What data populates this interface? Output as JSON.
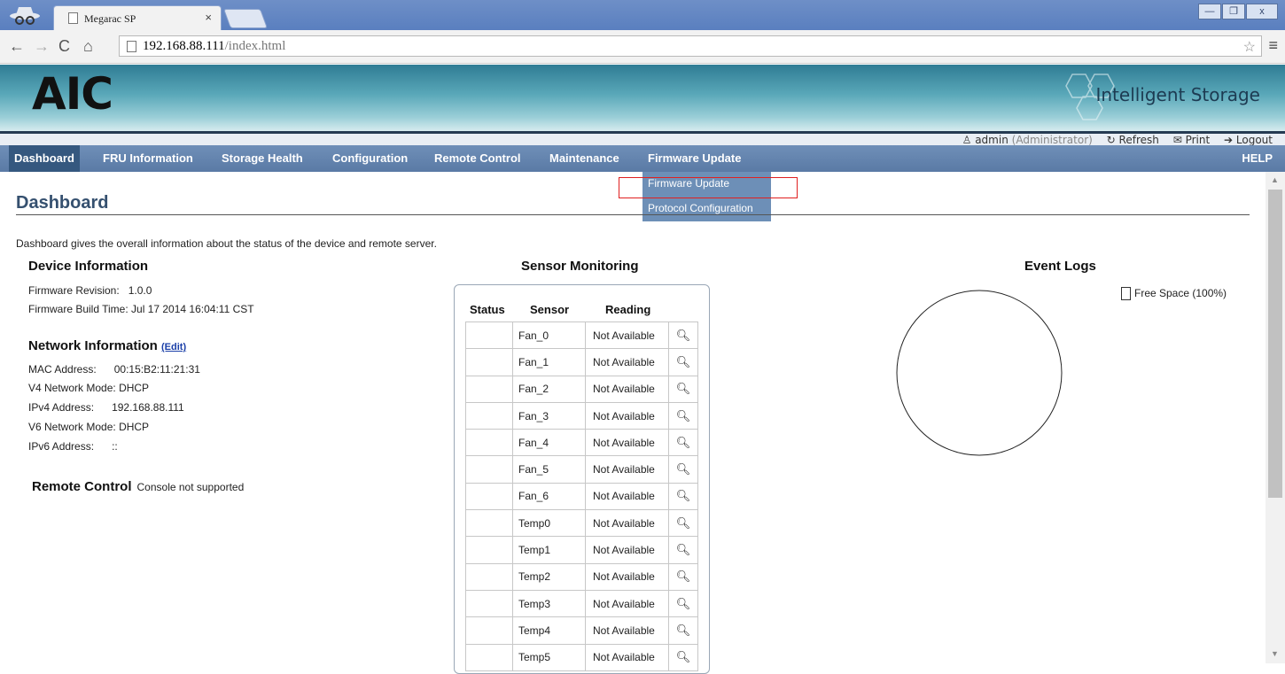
{
  "browser": {
    "tab_title": "Megarac SP",
    "tab_close": "×",
    "url_host": "192.168.88.111",
    "url_path": "/index.html",
    "window_controls": [
      "—",
      "❐",
      "x"
    ]
  },
  "header": {
    "logo": "AIC",
    "tagline": "Intelligent Storage"
  },
  "userbar": {
    "user": "admin",
    "role": "(Administrator)",
    "refresh": "Refresh",
    "print": "Print",
    "logout": "Logout"
  },
  "nav": {
    "items": [
      "Dashboard",
      "FRU Information",
      "Storage Health",
      "Configuration",
      "Remote Control",
      "Maintenance",
      "Firmware Update"
    ],
    "help": "HELP",
    "dropdown": [
      "Firmware Update",
      "Protocol Configuration"
    ]
  },
  "page": {
    "title": "Dashboard",
    "description": "Dashboard gives the overall information about the status of the device and remote server."
  },
  "device_info": {
    "heading": "Device Information",
    "firmware_revision_label": "Firmware Revision:",
    "firmware_revision": "1.0.0",
    "build_time_label": "Firmware Build Time:",
    "build_time": "Jul 17 2014 16:04:11 CST"
  },
  "network_info": {
    "heading": "Network Information",
    "edit": "(Edit)",
    "mac_label": "MAC Address:",
    "mac": "00:15:B2:11:21:31",
    "v4_mode_label": "V4 Network Mode:",
    "v4_mode": "DHCP",
    "ipv4_label": "IPv4 Address:",
    "ipv4": "192.168.88.111",
    "v6_mode_label": "V6 Network Mode:",
    "v6_mode": "DHCP",
    "ipv6_label": "IPv6 Address:",
    "ipv6": "::"
  },
  "remote_control": {
    "heading": "Remote Control",
    "status": "Console not supported"
  },
  "sensor_monitoring": {
    "heading": "Sensor Monitoring",
    "columns": [
      "Status",
      "Sensor",
      "Reading"
    ],
    "rows": [
      {
        "sensor": "Fan_0",
        "reading": "Not Available"
      },
      {
        "sensor": "Fan_1",
        "reading": "Not Available"
      },
      {
        "sensor": "Fan_2",
        "reading": "Not Available"
      },
      {
        "sensor": "Fan_3",
        "reading": "Not Available"
      },
      {
        "sensor": "Fan_4",
        "reading": "Not Available"
      },
      {
        "sensor": "Fan_5",
        "reading": "Not Available"
      },
      {
        "sensor": "Fan_6",
        "reading": "Not Available"
      },
      {
        "sensor": "Temp0",
        "reading": "Not Available"
      },
      {
        "sensor": "Temp1",
        "reading": "Not Available"
      },
      {
        "sensor": "Temp2",
        "reading": "Not Available"
      },
      {
        "sensor": "Temp3",
        "reading": "Not Available"
      },
      {
        "sensor": "Temp4",
        "reading": "Not Available"
      },
      {
        "sensor": "Temp5",
        "reading": "Not Available"
      }
    ]
  },
  "event_logs": {
    "heading": "Event Logs",
    "legend": "Free Space (100%)",
    "free_space_fraction": 1.0
  },
  "colors": {
    "nav_bg": "#5a7aa5",
    "nav_active": "#35587f",
    "highlight": "#e02020"
  }
}
